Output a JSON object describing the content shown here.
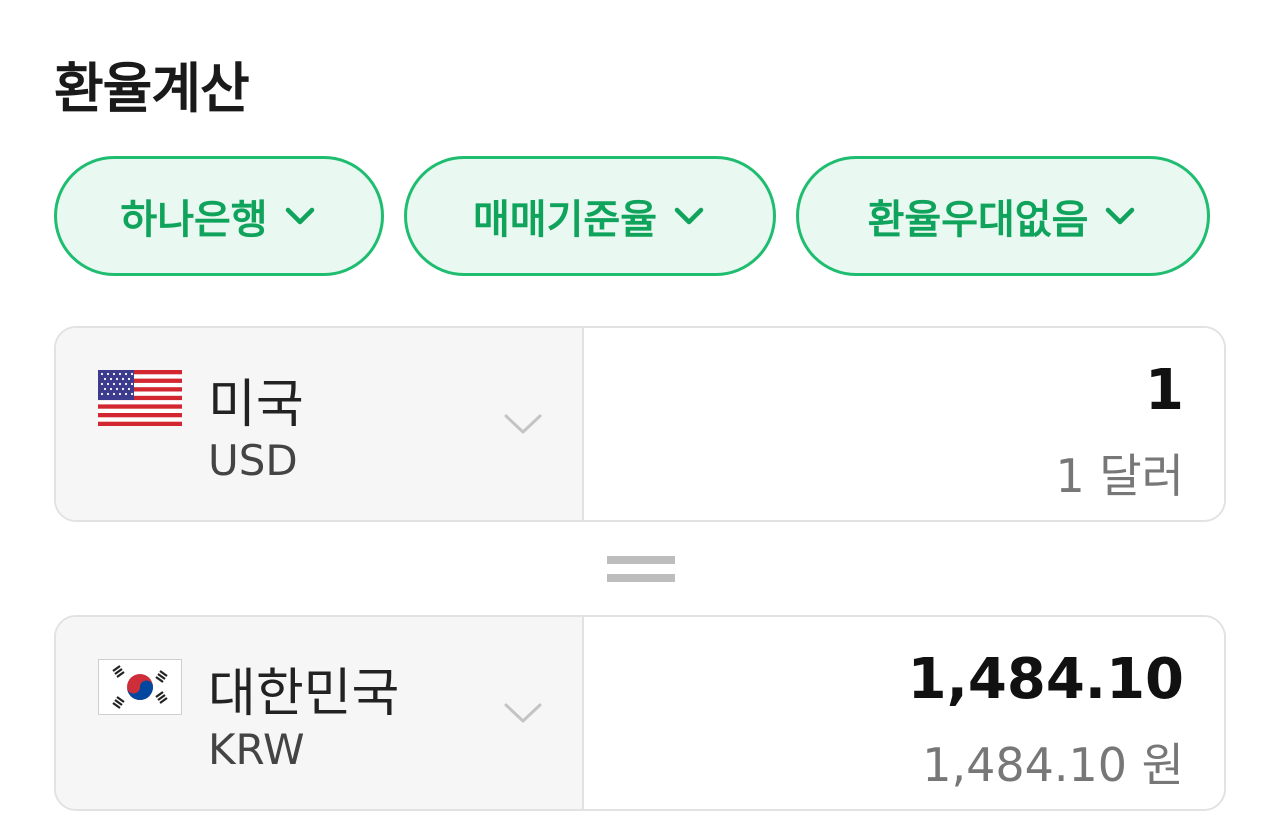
{
  "title": "환율계산",
  "filters": {
    "bank": "하나은행",
    "rate_type": "매매기준율",
    "preference": "환율우대없음"
  },
  "from": {
    "country": "미국",
    "code": "USD",
    "amount": "1",
    "amount_text": "1 달러",
    "flag_icon": "us-flag-icon"
  },
  "to": {
    "country": "대한민국",
    "code": "KRW",
    "amount": "1,484.10",
    "amount_text": "1,484.10 원",
    "flag_icon": "kr-flag-icon"
  },
  "colors": {
    "accent": "#1ebd70",
    "accent_text": "#10a35c",
    "chip_bg": "#e9f8f0",
    "panel_bg": "#f6f6f6"
  }
}
